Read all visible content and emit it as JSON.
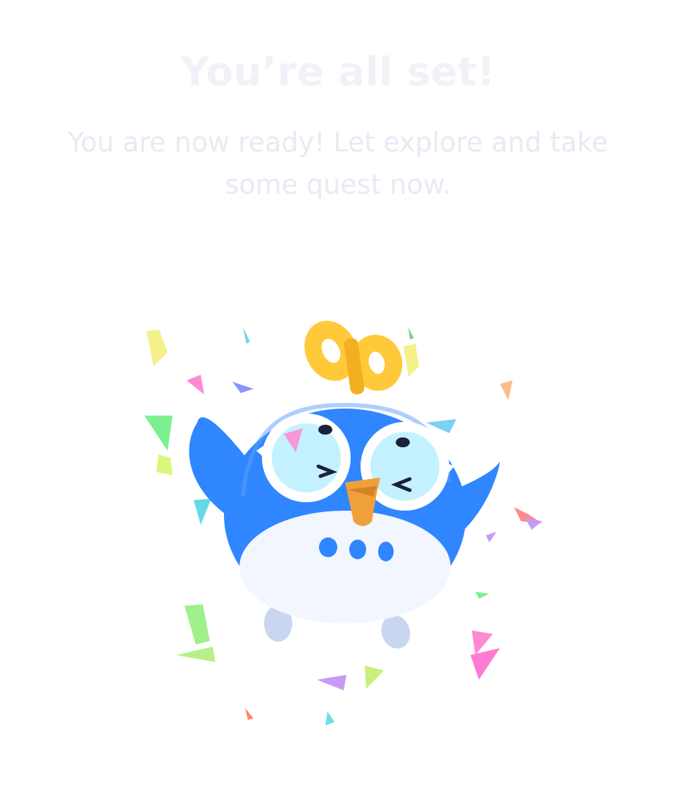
{
  "screen": {
    "title": "You’re all set!",
    "subtitle": "You are now ready! Let explore and take some quest now."
  },
  "illustration": {
    "name": "owl-mascot-celebrating",
    "colors": {
      "body": "#2f86ff",
      "belly": "#f2f6ff",
      "beak": "#f0a03a",
      "glasses": "#ffffff",
      "key": "#ffc93a"
    }
  }
}
